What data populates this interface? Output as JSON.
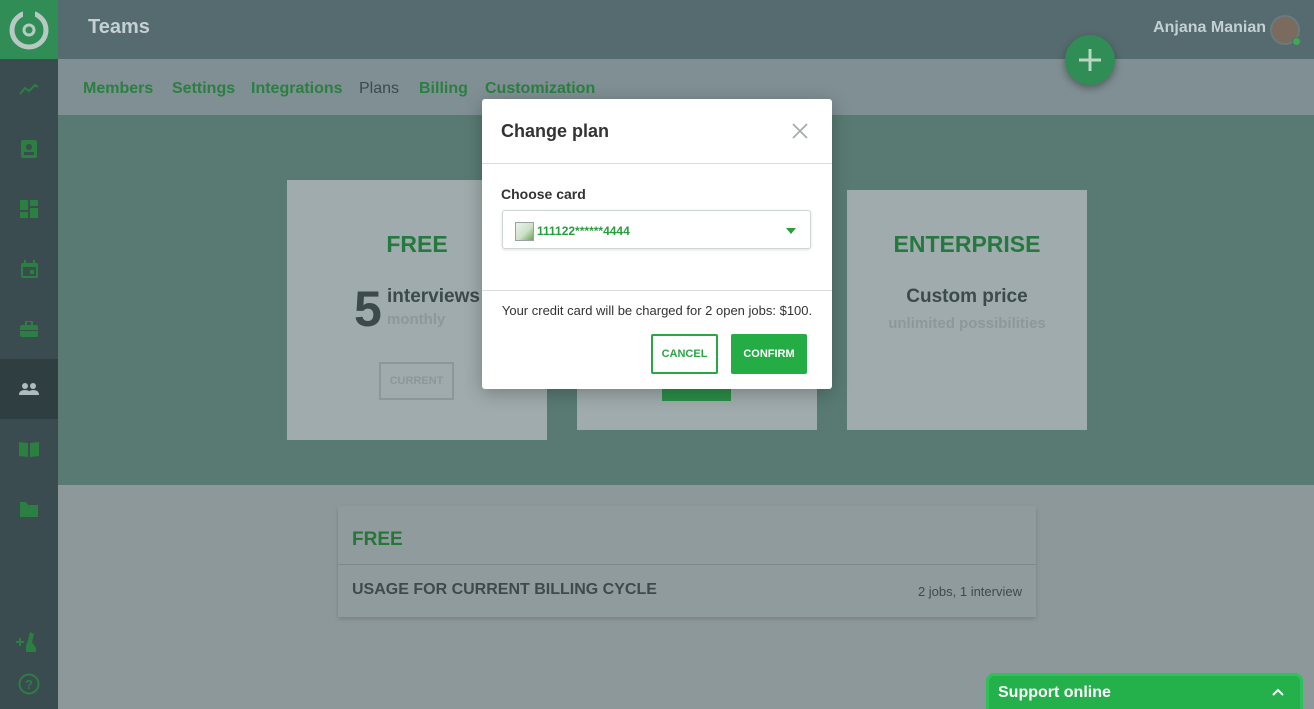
{
  "app": {
    "section_title": "Teams"
  },
  "user": {
    "name": "Anjana Manian"
  },
  "sidebar": {
    "items": [
      {
        "icon": "chart-line-icon"
      },
      {
        "icon": "contact-card-icon"
      },
      {
        "icon": "dashboard-icon"
      },
      {
        "icon": "calendar-icon"
      },
      {
        "icon": "briefcase-icon"
      },
      {
        "icon": "team-icon",
        "active": true
      },
      {
        "icon": "book-icon"
      },
      {
        "icon": "folder-icon"
      }
    ],
    "bottom": [
      {
        "icon": "add-integration-icon"
      },
      {
        "icon": "help-icon"
      }
    ]
  },
  "tabs": [
    {
      "label": "Members"
    },
    {
      "label": "Settings"
    },
    {
      "label": "Integrations"
    },
    {
      "label": "Plans",
      "active": true
    },
    {
      "label": "Billing"
    },
    {
      "label": "Customization"
    }
  ],
  "plans": {
    "free": {
      "name": "FREE",
      "count": "5",
      "unit": "interviews",
      "period": "monthly",
      "button": "CURRENT"
    },
    "enterprise": {
      "name": "ENTERPRISE",
      "price": "Custom price",
      "tagline": "unlimited possibilities"
    }
  },
  "usage": {
    "plan": "FREE",
    "label": "USAGE FOR CURRENT BILLING CYCLE",
    "value": "2 jobs, 1 interview"
  },
  "modal": {
    "title": "Change plan",
    "field_label": "Choose card",
    "selected_card": "111122******4444",
    "charge_text": "Your credit card will be charged for 2 open jobs: $100.",
    "cancel_label": "CANCEL",
    "confirm_label": "CONFIRM"
  },
  "support": {
    "label": "Support online"
  },
  "colors": {
    "accent": "#28a745",
    "sidebar": "#3a4c4f",
    "brand": "#2f8d55"
  }
}
